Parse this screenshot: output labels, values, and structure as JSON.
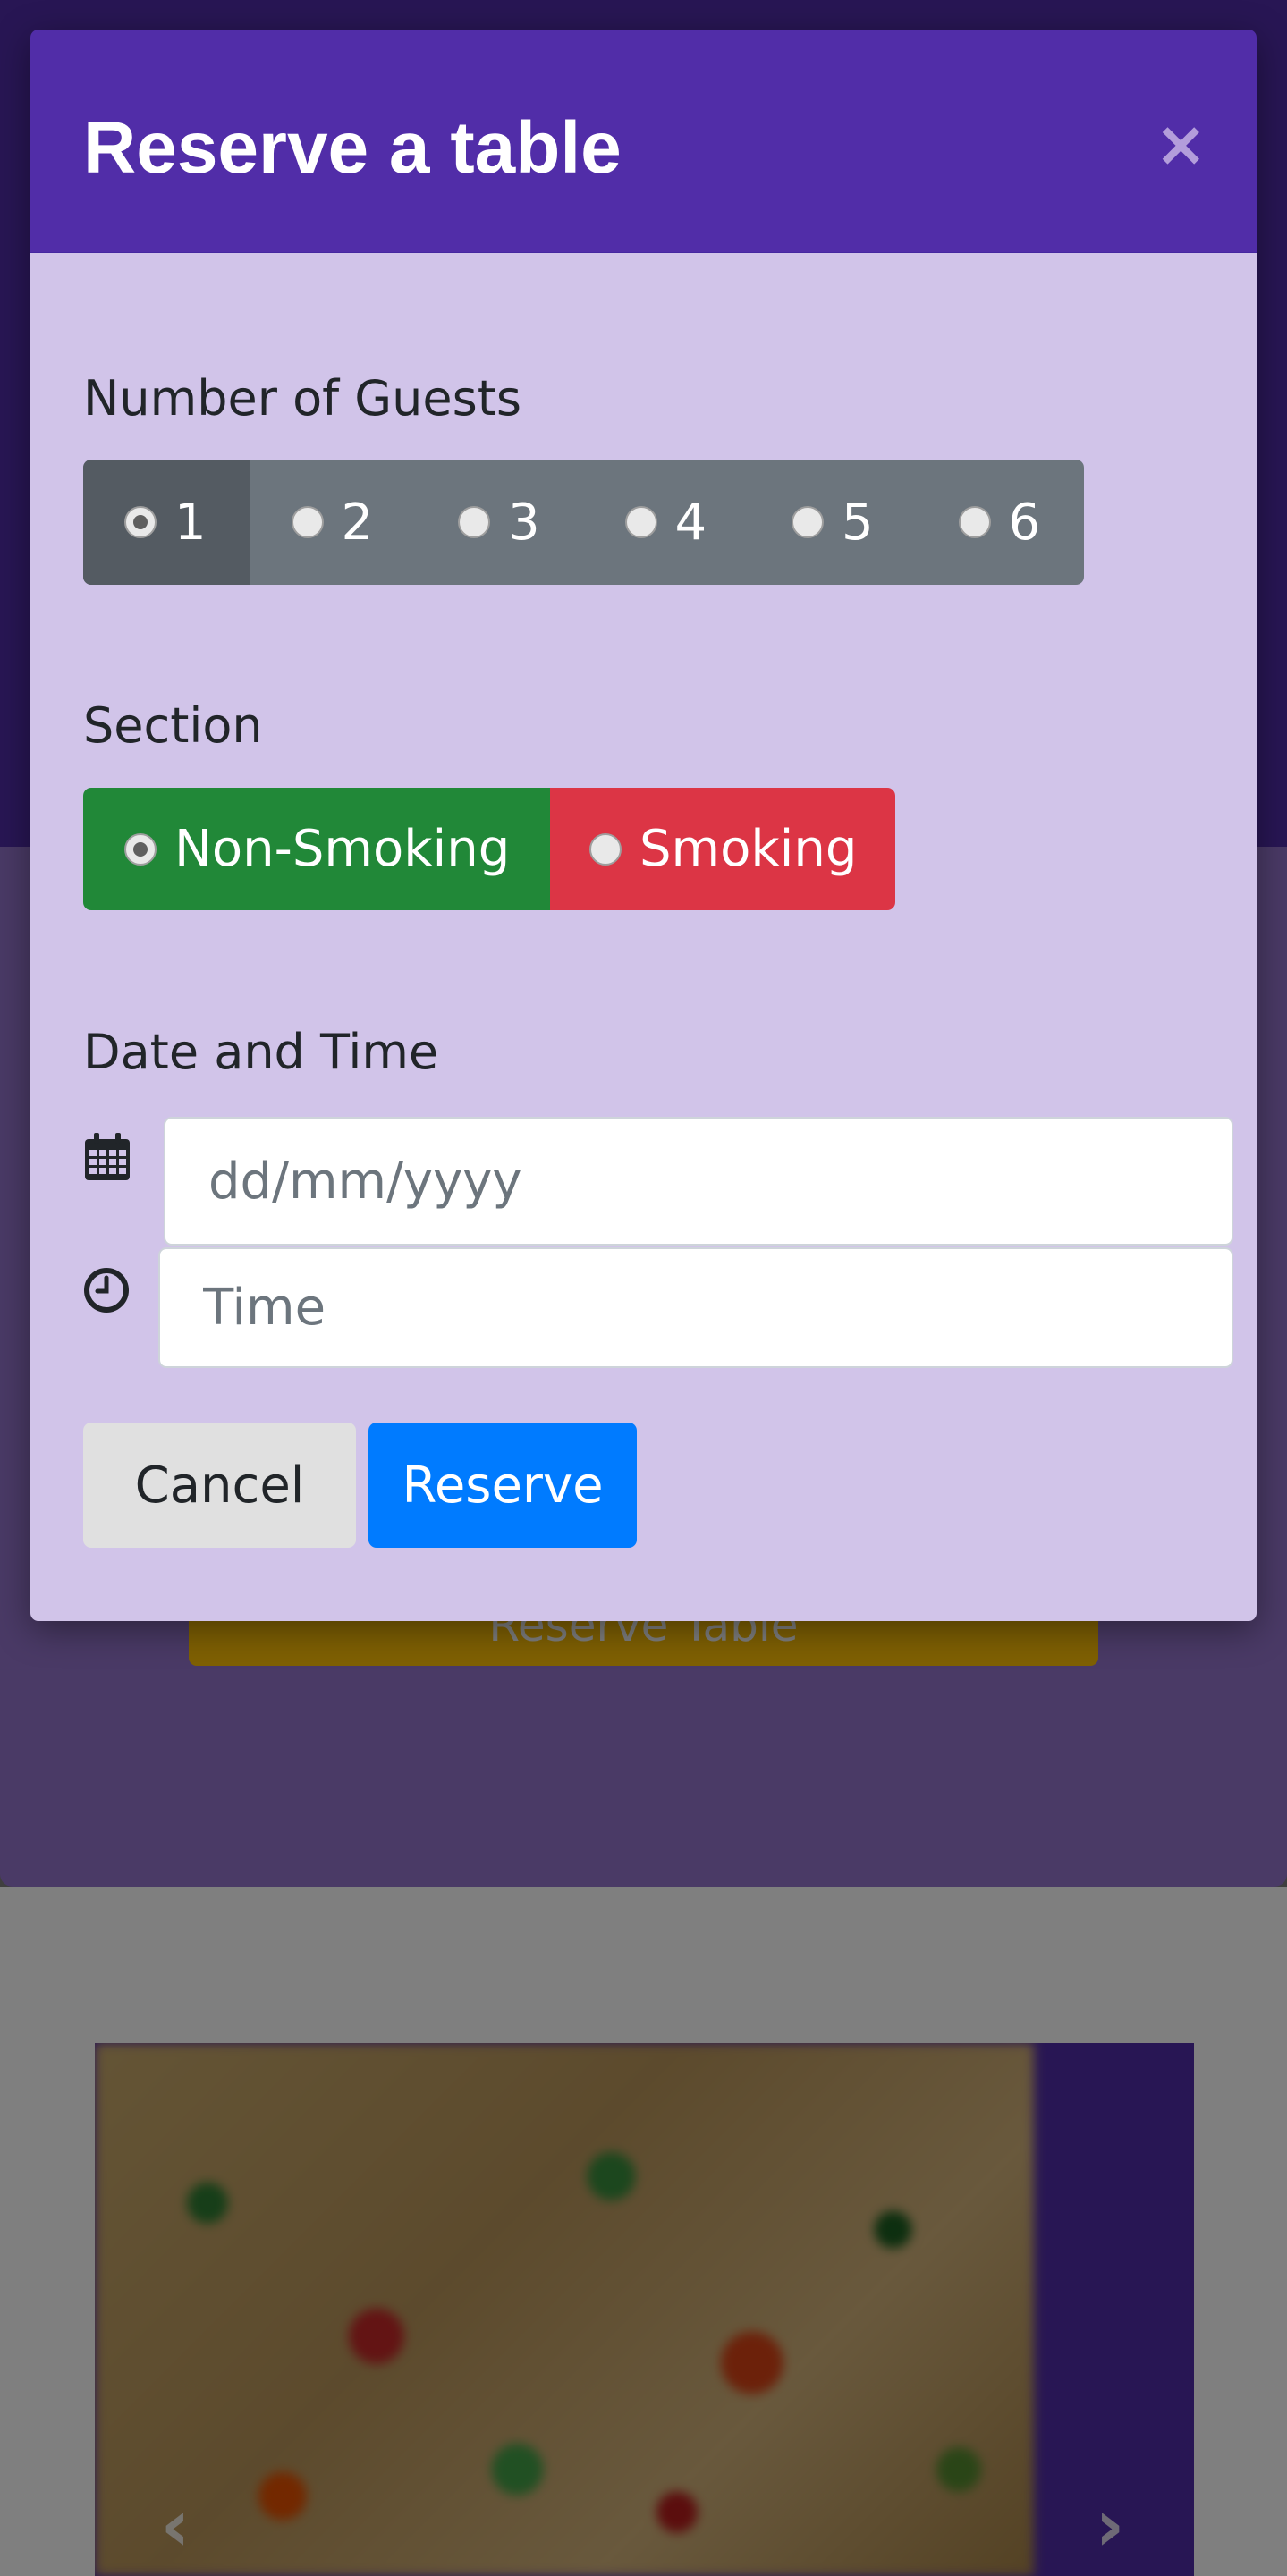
{
  "background": {
    "reserve_button_label": "Reserve Table"
  },
  "modal": {
    "title": "Reserve a table",
    "close_label": "×",
    "guests": {
      "label": "Number of Guests",
      "options": [
        "1",
        "2",
        "3",
        "4",
        "5",
        "6"
      ],
      "selected": "1"
    },
    "section": {
      "label": "Section",
      "options": [
        "Non-Smoking",
        "Smoking"
      ],
      "selected": "Non-Smoking"
    },
    "datetime": {
      "label": "Date and Time",
      "date_placeholder": "dd/mm/yyyy",
      "time_placeholder": "Time"
    },
    "buttons": {
      "cancel": "Cancel",
      "reserve": "Reserve"
    }
  },
  "carousel": {
    "prev_label": "‹",
    "next_label": "›"
  },
  "colors": {
    "primary": "#512da8",
    "modal_body": "#d1c4e9",
    "success": "#218838",
    "danger": "#dc3545",
    "secondary": "#6c757d",
    "reserve_blue": "#007bff",
    "warning": "#ffc107"
  },
  "icons": {
    "date": "calendar-icon",
    "time": "clock-icon",
    "close": "close-icon"
  }
}
